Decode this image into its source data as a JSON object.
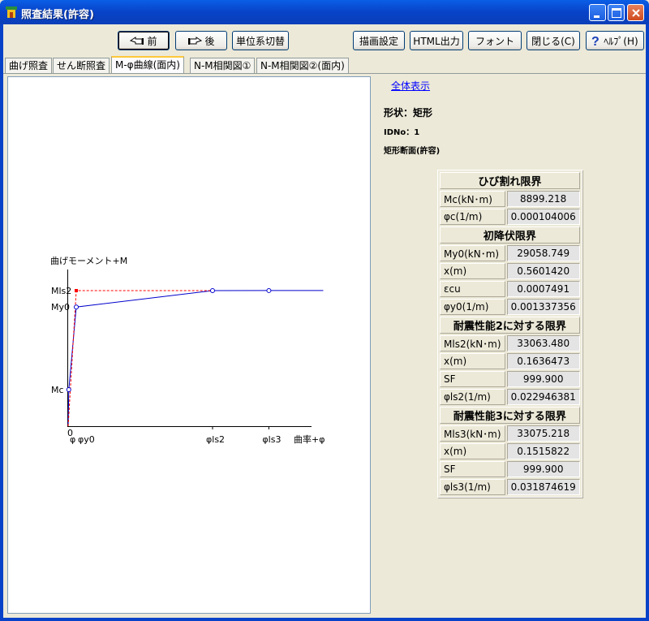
{
  "window": {
    "title": "照査結果(許容)"
  },
  "toolbar": {
    "prev": "前",
    "next": "後",
    "unit_switch": "単位系切替",
    "draw_settings": "描画設定",
    "html_output": "HTML出力",
    "font": "フォント",
    "close": "閉じる(C)",
    "help": "ﾍﾙﾌﾟ(H)"
  },
  "tabs": [
    "曲げ照査",
    "せん断照査",
    "M-φ曲線(面内)",
    "N-M相関図①",
    "N-M相関図②(面内)"
  ],
  "active_tab": 2,
  "info": {
    "show_all": "全体表示",
    "shape": "形状：矩形",
    "id": "IDNo：1",
    "section": "矩形断面(許容)"
  },
  "results": {
    "crack": {
      "header": "ひび割れ限界",
      "rows": [
        {
          "label": "Mc(kN･m)",
          "value": "8899.218"
        },
        {
          "label": "φc(1/m)",
          "value": "0.000104006"
        }
      ]
    },
    "yield": {
      "header": "初降伏限界",
      "rows": [
        {
          "label": "My0(kN･m)",
          "value": "29058.749"
        },
        {
          "label": "x(m)",
          "value": "0.5601420"
        },
        {
          "label": "εcu",
          "value": "0.0007491"
        },
        {
          "label": "φy0(1/m)",
          "value": "0.001337356"
        }
      ]
    },
    "perf2": {
      "header": "耐震性能2に対する限界",
      "rows": [
        {
          "label": "Mls2(kN･m)",
          "value": "33063.480"
        },
        {
          "label": "x(m)",
          "value": "0.1636473"
        },
        {
          "label": "SF",
          "value": "999.900"
        },
        {
          "label": "φls2(1/m)",
          "value": "0.022946381"
        }
      ]
    },
    "perf3": {
      "header": "耐震性能3に対する限界",
      "rows": [
        {
          "label": "Mls3(kN･m)",
          "value": "33075.218"
        },
        {
          "label": "x(m)",
          "value": "0.1515822"
        },
        {
          "label": "SF",
          "value": "999.900"
        },
        {
          "label": "φls3(1/m)",
          "value": "0.031874619"
        }
      ]
    }
  },
  "chart_data": {
    "type": "line",
    "ylabel": "曲げモーメント+M",
    "xlabel": "曲率+φ",
    "origin_label": "0",
    "ytick_labels": [
      "Mls2",
      "My0",
      "Mc"
    ],
    "xtick_labels": [
      "φ",
      "φy0",
      "φls2",
      "φls3"
    ],
    "series": [
      {
        "style": "solid",
        "color": "#0000cc",
        "x": [
          0,
          0.000104006,
          0.001337356,
          0.022946381,
          0.031874619,
          0.0405
        ],
        "y": [
          0,
          8899.218,
          29058.749,
          33063.48,
          33075.218,
          33075.218
        ],
        "markers": [
          1,
          2,
          3,
          4
        ]
      },
      {
        "style": "dashed",
        "color": "#ff0000",
        "x": [
          0,
          0.001337356,
          0.022946381
        ],
        "y": [
          0,
          33063.48,
          33063.48
        ],
        "markers": [
          1
        ]
      }
    ],
    "xlim": [
      0,
      0.0405
    ],
    "ylim": [
      0,
      33063.48
    ]
  }
}
